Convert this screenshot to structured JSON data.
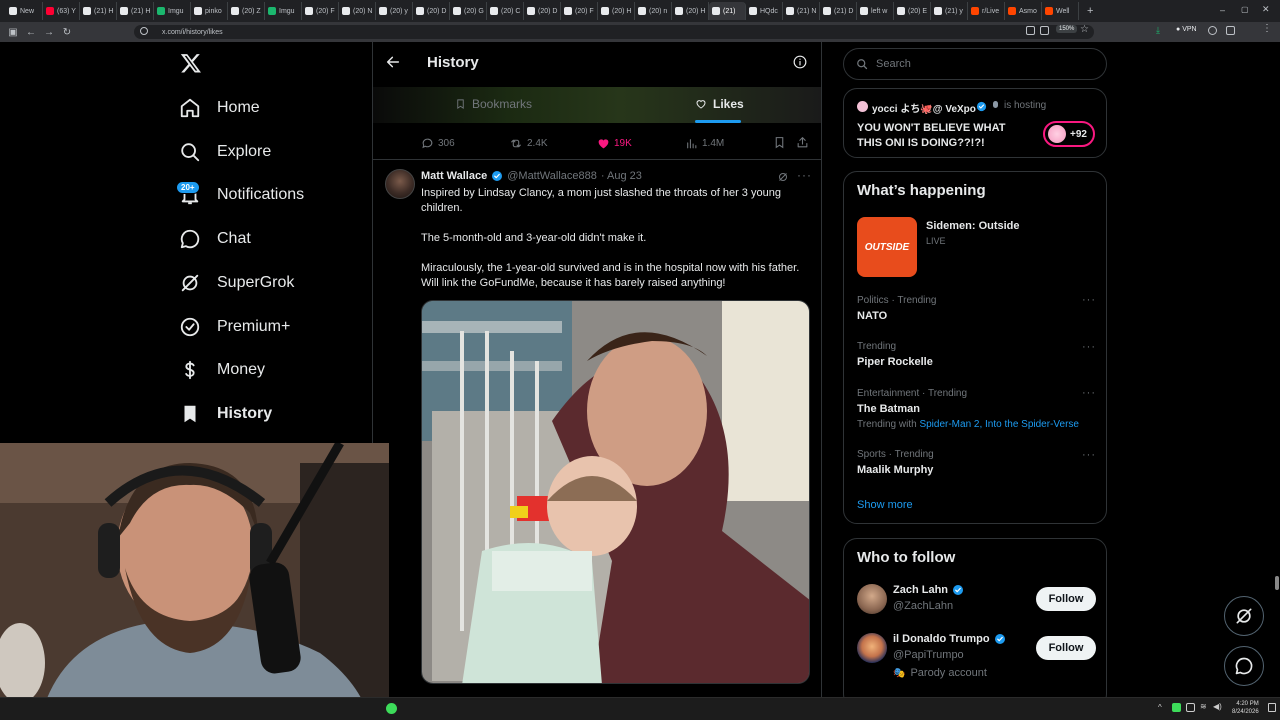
{
  "browser": {
    "tabs": [
      {
        "label": "New",
        "color": "#e8eaed"
      },
      {
        "label": "(63) Y",
        "color": "#ff0033"
      },
      {
        "label": "(21) H",
        "color": "#e8eaed"
      },
      {
        "label": "(21) H",
        "color": "#e8eaed"
      },
      {
        "label": "Imgu",
        "color": "#1bb76e"
      },
      {
        "label": "pinko",
        "color": "#e8eaed"
      },
      {
        "label": "(20) Z",
        "color": "#e8eaed"
      },
      {
        "label": "Imgu",
        "color": "#1bb76e"
      },
      {
        "label": "(20) F",
        "color": "#e8eaed"
      },
      {
        "label": "(20) N",
        "color": "#e8eaed"
      },
      {
        "label": "(20) y",
        "color": "#e8eaed"
      },
      {
        "label": "(20) D",
        "color": "#e8eaed"
      },
      {
        "label": "(20) G",
        "color": "#e8eaed"
      },
      {
        "label": "(20) C",
        "color": "#e8eaed"
      },
      {
        "label": "(20) D",
        "color": "#e8eaed"
      },
      {
        "label": "(20) F",
        "color": "#e8eaed"
      },
      {
        "label": "(20) H",
        "color": "#e8eaed"
      },
      {
        "label": "(20) n",
        "color": "#e8eaed"
      },
      {
        "label": "(20) H",
        "color": "#e8eaed"
      },
      {
        "label": "(21)",
        "color": "#e8eaed",
        "active": true
      },
      {
        "label": "HQdc",
        "color": "#e8eaed"
      },
      {
        "label": "(21) N",
        "color": "#e8eaed"
      },
      {
        "label": "(21) D",
        "color": "#e8eaed"
      },
      {
        "label": "left w",
        "color": "#e8eaed"
      },
      {
        "label": "(20) E",
        "color": "#e8eaed"
      },
      {
        "label": "(21) y",
        "color": "#e8eaed"
      },
      {
        "label": "r/Live",
        "color": "#ff4500"
      },
      {
        "label": "Asmo",
        "color": "#ff4500"
      },
      {
        "label": "Well",
        "color": "#ff4500"
      }
    ],
    "url": "x.com/i/history/likes",
    "zoom": "150%",
    "vpn": "VPN"
  },
  "nav": {
    "items": [
      {
        "label": "Home",
        "icon": "home-icon"
      },
      {
        "label": "Explore",
        "icon": "search-icon"
      },
      {
        "label": "Notifications",
        "icon": "bell-icon"
      },
      {
        "label": "Chat",
        "icon": "chat-icon"
      },
      {
        "label": "SuperGrok",
        "icon": "grok-icon"
      },
      {
        "label": "Premium+",
        "icon": "verified-icon"
      },
      {
        "label": "Money",
        "icon": "money-icon"
      },
      {
        "label": "History",
        "icon": "bookmark-icon"
      }
    ],
    "notif_badge": "20+"
  },
  "header": {
    "title": "History",
    "tabs": [
      {
        "label": "Bookmarks"
      },
      {
        "label": "Likes"
      }
    ]
  },
  "prev_tweet": {
    "replies": "306",
    "reposts": "2.4K",
    "likes": "19K",
    "views": "1.4M"
  },
  "tweet": {
    "author": "Matt Wallace",
    "handle": "@MattWallace888",
    "date": "· Aug 23",
    "para1": "Inspired by Lindsay Clancy, a mom just slashed the throats of her 3 young children.",
    "para2": "The 5-month-old and 3-year-old didn't make it.",
    "para3": "Miraculously, the 1-year-old survived and is in the hospital now with his father. Will link the GoFundMe, because it has barely raised anything!"
  },
  "sidebar": {
    "search_placeholder": "Search",
    "live": {
      "host": "yocci よち🐙@ VeXpo",
      "hosting": "is hosting",
      "title": "YOU WON'T BELIEVE WHAT THIS ONI IS DOING??!?!",
      "count": "+92"
    },
    "happening": {
      "title": "What’s happening",
      "feature": {
        "name": "Sidemen: Outside",
        "status": "LIVE",
        "thumb_text": "OUTSIDE"
      },
      "trends": [
        {
          "category": "Politics · Trending",
          "name": "NATO"
        },
        {
          "category": "Trending",
          "name": "Piper Rockelle"
        },
        {
          "category": "Entertainment · Trending",
          "name": "The Batman",
          "with_prefix": "Trending with ",
          "with": "Spider-Man 2, Into the Spider-Verse"
        },
        {
          "category": "Sports · Trending",
          "name": "Maalik Murphy"
        }
      ],
      "show_more": "Show more"
    },
    "follow": {
      "title": "Who to follow",
      "users": [
        {
          "name": "Zach Lahn",
          "handle": "@ZachLahn",
          "button": "Follow"
        },
        {
          "name": "il Donaldo Trumpo",
          "handle": "@PapiTrumpo",
          "note": "Parody account",
          "button": "Follow"
        }
      ]
    }
  },
  "taskbar": {
    "time": "4:20 PM",
    "date": "8/24/2026"
  },
  "colors": {
    "accent": "#1d9bf0",
    "like": "#f91880",
    "muted": "#71767b",
    "border": "#2f3336"
  }
}
